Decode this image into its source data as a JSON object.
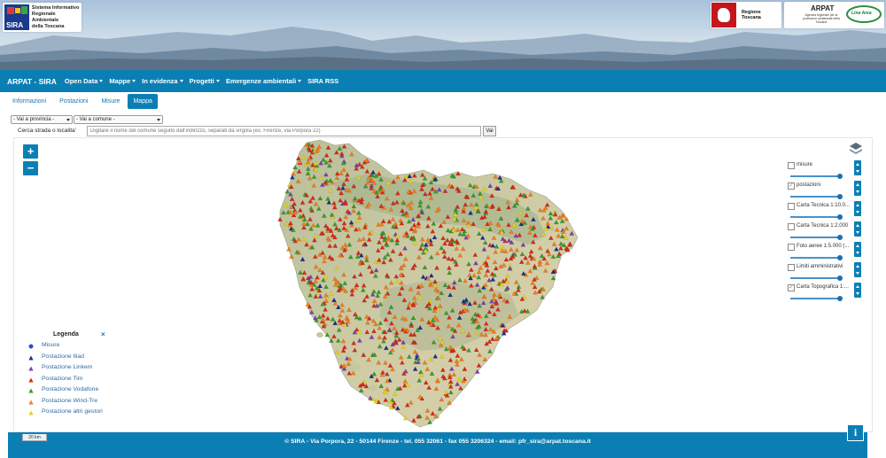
{
  "header": {
    "sira_logo": {
      "mark": "SIRA",
      "lines": [
        "Sistema Informativo",
        "Regionale Ambientale",
        "della Toscana"
      ]
    },
    "regione_logo": "Regione Toscana",
    "arpat_logo": {
      "title": "ARPAT",
      "subtitle": "Agenzia regionale per la protezione ambientale della Toscana",
      "badge": "Lina Area"
    }
  },
  "navbar": {
    "brand": "ARPAT - SIRA",
    "items": [
      {
        "label": "Open Data",
        "dropdown": true
      },
      {
        "label": "Mappe",
        "dropdown": true
      },
      {
        "label": "In evidenza",
        "dropdown": true
      },
      {
        "label": "Progetti",
        "dropdown": true
      },
      {
        "label": "Emergenze ambientali",
        "dropdown": true
      },
      {
        "label": "SIRA RSS",
        "dropdown": false
      }
    ],
    "bg_color": "#0b7fb4"
  },
  "tabs": [
    {
      "label": "Informazioni",
      "active": false
    },
    {
      "label": "Postazioni",
      "active": false
    },
    {
      "label": "Misure",
      "active": false
    },
    {
      "label": "Mappa",
      "active": true
    }
  ],
  "filters": {
    "provincia_select": "- Vai a provincia -",
    "comune_select": "- Vai a comune -",
    "search_label": "Cerca strada o localita'",
    "search_placeholder": "Digitare il nome del comune seguito dall'indirizzo, separati da virgola (es: Firenze, via Porpora 22)",
    "search_button": "Vai"
  },
  "map": {
    "zoom_in": "+",
    "zoom_out": "−",
    "scale_label": "20 km",
    "icons": {
      "layers": "layers-icon",
      "info": "info-icon"
    }
  },
  "layers": [
    {
      "label": "misure",
      "checked": false
    },
    {
      "label": "postazioni",
      "checked": true
    },
    {
      "label": "Carta Tecnica 1:10.0...",
      "checked": false
    },
    {
      "label": "Carta Tecnica 1:2.000",
      "checked": false
    },
    {
      "label": "Foto aeree 1:5.000 (...",
      "checked": false
    },
    {
      "label": "Limiti amministrativi",
      "checked": false
    },
    {
      "label": "Carta Topografica 1:...",
      "checked": true
    }
  ],
  "legend": {
    "title": "Legenda",
    "close": "×",
    "items": [
      {
        "label": "Misure",
        "shape": "circle",
        "color": "#2a52c8"
      },
      {
        "label": "Postazione Iliad",
        "shape": "triangle",
        "color": "#1c2e8a"
      },
      {
        "label": "Postazione Linkem",
        "shape": "triangle",
        "color": "#7b3fb0"
      },
      {
        "label": "Postazione Tim",
        "shape": "triangle",
        "color": "#d42a1a"
      },
      {
        "label": "Postazione Vodafone",
        "shape": "triangle",
        "color": "#3a9a2c"
      },
      {
        "label": "Postazione Wind-Tre",
        "shape": "triangle",
        "color": "#ef7d1a"
      },
      {
        "label": "Postazione altri gestori",
        "shape": "triangle",
        "color": "#e6d21a"
      }
    ]
  },
  "footer": {
    "text": "© SIRA - Via Porpora, 22 - 50144 Firenze - tel. 055 32061 - fax 055 3206324 - email: pfr_sira@arpat.toscana.it"
  }
}
